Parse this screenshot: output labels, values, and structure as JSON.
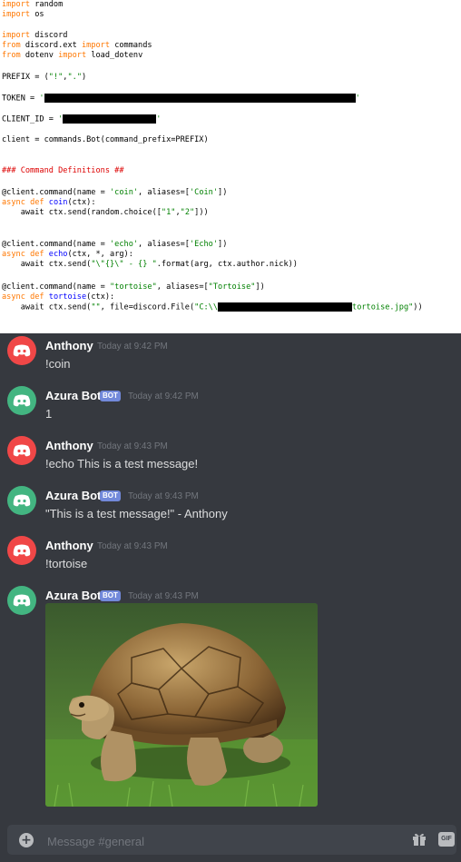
{
  "code": {
    "import_kw": "import",
    "from_kw": "from",
    "async_kw": "async",
    "def_kw": "def",
    "mod_random": " random",
    "mod_os": " os",
    "mod_discord": " discord",
    "discord_ext": " discord.ext ",
    "commands_mod": " commands",
    "dotenv_mod": " dotenv ",
    "load_dotenv": " load_dotenv",
    "prefix_assign": "PREFIX = (",
    "prefix_val1": "\"!\"",
    "comma": ",",
    "prefix_val2": "\".\"",
    "prefix_close": ")",
    "token_assign": "TOKEN = ",
    "client_id_assign": "CLIENT_ID = ",
    "quote": "'",
    "client_line": "client = commands.Bot(command_prefix=PREFIX)",
    "comment": "### Command Definitions ##",
    "dec_coin_a": "@client.command(name = ",
    "dec_coin_name": "'coin'",
    "dec_coin_b": ", aliases=[",
    "dec_coin_alias": "'Coin'",
    "dec_close": "])",
    "coin_fn": " coin",
    "coin_sig": "(ctx):",
    "coin_body_a": "    await ctx.send(random.choice([",
    "coin_choice1": "\"1\"",
    "coin_choice2": "\"2\"",
    "coin_body_b": "]))",
    "dec_echo_name": "'echo'",
    "dec_echo_alias": "'Echo'",
    "echo_fn": " echo",
    "echo_sig": "(ctx, *, arg):",
    "echo_body_a": "    await ctx.send(",
    "echo_str": "\"\\\"{}\\\" - {} \"",
    "echo_body_b": ".format(arg, ctx.author.nick))",
    "dec_tortoise_name": "\"tortoise\"",
    "dec_tortoise_alias": "\"Tortoise\"",
    "tortoise_fn": " tortoise",
    "tortoise_sig": "(ctx):",
    "tortoise_body_a": "    await ctx.send(",
    "tortoise_empty": "\"\"",
    "tortoise_body_b": ", file=discord.File(",
    "tortoise_path_a": "\"C:\\\\",
    "tortoise_path_b": "tortoise.jpg\"",
    "tortoise_body_c": "))"
  },
  "chat": {
    "colors": {
      "user_avatar": "#f04747",
      "bot_avatar": "#43b581",
      "bot_tag": "#7289da",
      "background": "#36393f"
    },
    "messages": [
      {
        "author": "Anthony",
        "timestamp": "Today at 9:42 PM",
        "text": "!coin",
        "bot": false
      },
      {
        "author": "Azura Bot",
        "tag": "BOT",
        "timestamp": "Today at 9:42 PM",
        "text": "1",
        "bot": true
      },
      {
        "author": "Anthony",
        "timestamp": "Today at 9:43 PM",
        "text": "!echo This is a test message!",
        "bot": false
      },
      {
        "author": "Azura Bot",
        "tag": "BOT",
        "timestamp": "Today at 9:43 PM",
        "text": "\"This is a test message!\" - Anthony",
        "bot": true
      },
      {
        "author": "Anthony",
        "timestamp": "Today at 9:43 PM",
        "text": "!tortoise",
        "bot": false
      },
      {
        "author": "Azura Bot",
        "tag": "BOT",
        "timestamp": "Today at 9:43 PM",
        "text": "",
        "bot": true,
        "attachment": "tortoise-photo"
      }
    ],
    "composer": {
      "placeholder": "Message #general",
      "gift_icon": "gift-icon",
      "gif_label": "GIF"
    }
  }
}
